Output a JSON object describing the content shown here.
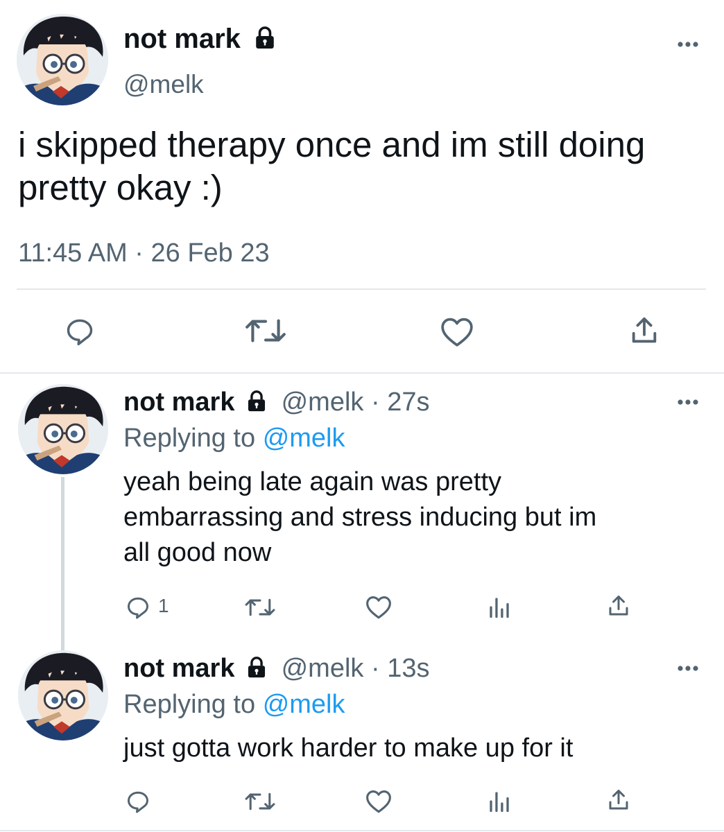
{
  "main_tweet": {
    "display_name": "not mark",
    "handle": "@melk",
    "text_line1": "i skipped therapy once and im still doing",
    "text_line2": "pretty okay :)",
    "timestamp": "11:45 AM · 26 Feb 23",
    "icons": [
      "reply-icon",
      "retweet-icon",
      "like-icon",
      "share-icon"
    ]
  },
  "replies": [
    {
      "display_name": "not mark",
      "handle": "@melk",
      "separator": "·",
      "time": "27s",
      "replying_prefix": "Replying to",
      "replying_to": "@melk",
      "text_line1": "yeah being late again was pretty",
      "text_line2": "embarrassing and stress inducing but im",
      "text_line3": "all good now",
      "reply_count": "1"
    },
    {
      "display_name": "not mark",
      "handle": "@melk",
      "separator": "·",
      "time": "13s",
      "replying_prefix": "Replying to",
      "replying_to": "@melk",
      "text_line1": "just gotta work harder to make up for it",
      "reply_count": ""
    }
  ],
  "colors": {
    "text": "#0f1419",
    "muted": "#536471",
    "link": "#1d9bf0",
    "divider": "#e4e8eb"
  }
}
